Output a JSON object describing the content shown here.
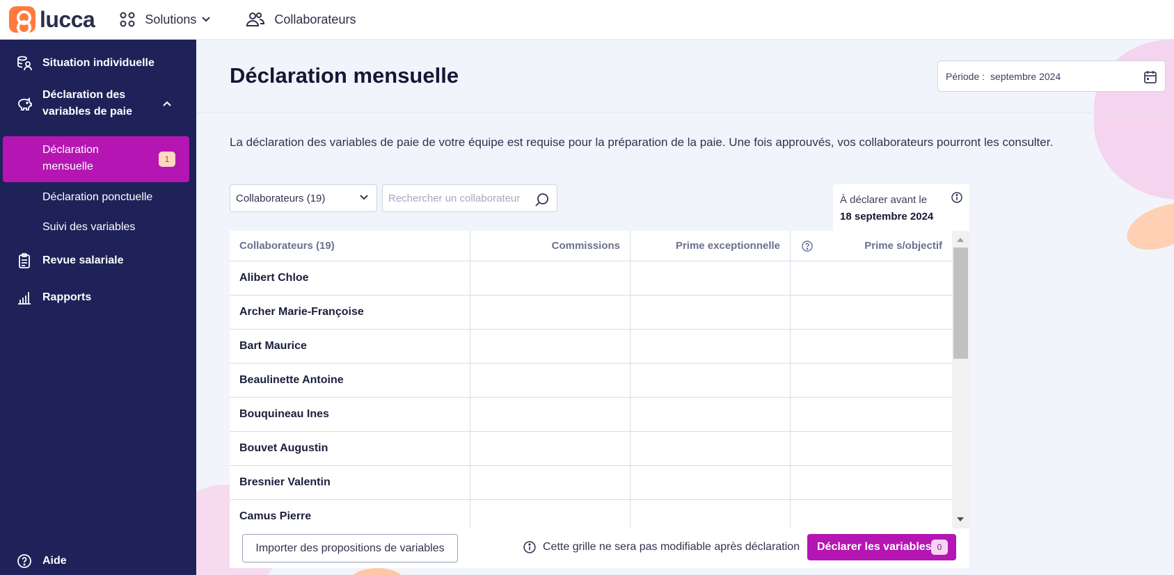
{
  "topbar": {
    "logo_text": "lucca",
    "nav": [
      {
        "label": "Solutions"
      },
      {
        "label": "Collaborateurs"
      }
    ]
  },
  "sidebar": {
    "items": [
      {
        "label": "Situation individuelle",
        "icon": "coins-person-icon"
      },
      {
        "label": "Déclaration des variables de paie",
        "icon": "piggy-bank-icon"
      },
      {
        "label": "Revue salariale",
        "icon": "clipboard-icon"
      },
      {
        "label": "Rapports",
        "icon": "bar-chart-icon"
      }
    ],
    "sub_items": [
      {
        "label": "Déclaration mensuelle",
        "badge": "1",
        "active": true
      },
      {
        "label": "Déclaration ponctuelle"
      },
      {
        "label": "Suivi des variables"
      }
    ],
    "help_label": "Aide"
  },
  "page": {
    "title": "Déclaration mensuelle",
    "period_label": "Période :",
    "period_value": "septembre 2024",
    "intro": "La déclaration des variables de paie de votre équipe est requise pour la préparation de la paie. Une fois approuvés, vos collaborateurs pourront les consulter."
  },
  "filters": {
    "collaborators_select": "Collaborateurs (19)",
    "search_placeholder": "Rechercher un collaborateur",
    "deadline_label": "À déclarer avant le",
    "deadline_date": "18 septembre 2024"
  },
  "table": {
    "columns": [
      "Collaborateurs (19)",
      "Commissions",
      "Prime exceptionnelle",
      "Prime s/objectif"
    ],
    "rows": [
      "Alibert Chloe",
      "Archer Marie-Françoise",
      "Bart Maurice",
      "Beaulinette Antoine",
      "Bouquineau Ines",
      "Bouvet Augustin",
      "Bresnier Valentin",
      "Camus Pierre"
    ]
  },
  "footer": {
    "import_label": "Importer des propositions de variables",
    "info_text": "Cette grille ne sera pas modifiable après déclaration",
    "declare_label": "Déclarer les variables",
    "declare_count": "0"
  },
  "colors": {
    "sidebar_bg": "#1e2259",
    "accent": "#b515b3",
    "logo": "#ff7a3d",
    "main_bg": "#f2f4fb"
  }
}
